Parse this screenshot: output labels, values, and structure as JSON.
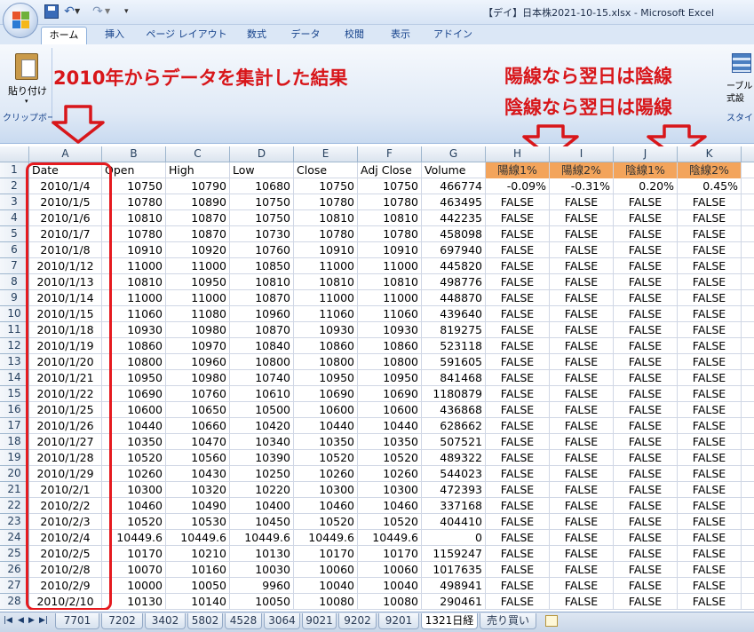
{
  "window": {
    "title": "【デイ】日本株2021-10-15.xlsx - Microsoft Excel"
  },
  "quick_access": {
    "save_icon": "save-icon",
    "undo_icon": "undo-icon",
    "redo_icon": "redo-icon",
    "undo_glyph": "↶",
    "redo_glyph": "↷",
    "dropdown_glyph": "▼",
    "customize_glyph": "▾"
  },
  "ribbon": {
    "tabs": [
      "ホーム",
      "挿入",
      "ページ レイアウト",
      "数式",
      "データ",
      "校閲",
      "表示",
      "アドイン"
    ],
    "active_tab": "ホーム",
    "paste_label": "貼り付け",
    "paste_arrow": "▾",
    "clipboard_group": "クリップボード",
    "right_label1": "ーブルと",
    "right_label2": "式設",
    "right_group": "スタイ"
  },
  "annotations": {
    "left": "2010年からデータを集計した結果",
    "right_line1": "陽線なら翌日は陰線",
    "right_line2": "陰線なら翌日は陽線",
    "color": "#d8161a"
  },
  "columns": [
    "A",
    "B",
    "C",
    "D",
    "E",
    "F",
    "G",
    "H",
    "I",
    "J",
    "K"
  ],
  "header_row": {
    "row_number": "1",
    "cells": [
      "Date",
      "Open",
      "High",
      "Low",
      "Close",
      "Adj Close",
      "Volume",
      "陽線1%",
      "陽線2%",
      "陰線1%",
      "陰線2%"
    ]
  },
  "rows": [
    {
      "n": "2",
      "cells": [
        "2010/1/4",
        "10750",
        "10790",
        "10680",
        "10750",
        "10750",
        "466774",
        "-0.09%",
        "-0.31%",
        "0.20%",
        "0.45%"
      ]
    },
    {
      "n": "3",
      "cells": [
        "2010/1/5",
        "10780",
        "10890",
        "10750",
        "10780",
        "10780",
        "463495",
        "FALSE",
        "FALSE",
        "FALSE",
        "FALSE"
      ]
    },
    {
      "n": "4",
      "cells": [
        "2010/1/6",
        "10810",
        "10870",
        "10750",
        "10810",
        "10810",
        "442235",
        "FALSE",
        "FALSE",
        "FALSE",
        "FALSE"
      ]
    },
    {
      "n": "5",
      "cells": [
        "2010/1/7",
        "10780",
        "10870",
        "10730",
        "10780",
        "10780",
        "458098",
        "FALSE",
        "FALSE",
        "FALSE",
        "FALSE"
      ]
    },
    {
      "n": "6",
      "cells": [
        "2010/1/8",
        "10910",
        "10920",
        "10760",
        "10910",
        "10910",
        "697940",
        "FALSE",
        "FALSE",
        "FALSE",
        "FALSE"
      ]
    },
    {
      "n": "7",
      "cells": [
        "2010/1/12",
        "11000",
        "11000",
        "10850",
        "11000",
        "11000",
        "445820",
        "FALSE",
        "FALSE",
        "FALSE",
        "FALSE"
      ]
    },
    {
      "n": "8",
      "cells": [
        "2010/1/13",
        "10810",
        "10950",
        "10810",
        "10810",
        "10810",
        "498776",
        "FALSE",
        "FALSE",
        "FALSE",
        "FALSE"
      ]
    },
    {
      "n": "9",
      "cells": [
        "2010/1/14",
        "11000",
        "11000",
        "10870",
        "11000",
        "11000",
        "448870",
        "FALSE",
        "FALSE",
        "FALSE",
        "FALSE"
      ]
    },
    {
      "n": "10",
      "cells": [
        "2010/1/15",
        "11060",
        "11080",
        "10960",
        "11060",
        "11060",
        "439640",
        "FALSE",
        "FALSE",
        "FALSE",
        "FALSE"
      ]
    },
    {
      "n": "11",
      "cells": [
        "2010/1/18",
        "10930",
        "10980",
        "10870",
        "10930",
        "10930",
        "819275",
        "FALSE",
        "FALSE",
        "FALSE",
        "FALSE"
      ]
    },
    {
      "n": "12",
      "cells": [
        "2010/1/19",
        "10860",
        "10970",
        "10840",
        "10860",
        "10860",
        "523118",
        "FALSE",
        "FALSE",
        "FALSE",
        "FALSE"
      ]
    },
    {
      "n": "13",
      "cells": [
        "2010/1/20",
        "10800",
        "10960",
        "10800",
        "10800",
        "10800",
        "591605",
        "FALSE",
        "FALSE",
        "FALSE",
        "FALSE"
      ]
    },
    {
      "n": "14",
      "cells": [
        "2010/1/21",
        "10950",
        "10980",
        "10740",
        "10950",
        "10950",
        "841468",
        "FALSE",
        "FALSE",
        "FALSE",
        "FALSE"
      ]
    },
    {
      "n": "15",
      "cells": [
        "2010/1/22",
        "10690",
        "10760",
        "10610",
        "10690",
        "10690",
        "1180879",
        "FALSE",
        "FALSE",
        "FALSE",
        "FALSE"
      ]
    },
    {
      "n": "16",
      "cells": [
        "2010/1/25",
        "10600",
        "10650",
        "10500",
        "10600",
        "10600",
        "436868",
        "FALSE",
        "FALSE",
        "FALSE",
        "FALSE"
      ]
    },
    {
      "n": "17",
      "cells": [
        "2010/1/26",
        "10440",
        "10660",
        "10420",
        "10440",
        "10440",
        "628662",
        "FALSE",
        "FALSE",
        "FALSE",
        "FALSE"
      ]
    },
    {
      "n": "18",
      "cells": [
        "2010/1/27",
        "10350",
        "10470",
        "10340",
        "10350",
        "10350",
        "507521",
        "FALSE",
        "FALSE",
        "FALSE",
        "FALSE"
      ]
    },
    {
      "n": "19",
      "cells": [
        "2010/1/28",
        "10520",
        "10560",
        "10390",
        "10520",
        "10520",
        "489322",
        "FALSE",
        "FALSE",
        "FALSE",
        "FALSE"
      ]
    },
    {
      "n": "20",
      "cells": [
        "2010/1/29",
        "10260",
        "10430",
        "10250",
        "10260",
        "10260",
        "544023",
        "FALSE",
        "FALSE",
        "FALSE",
        "FALSE"
      ]
    },
    {
      "n": "21",
      "cells": [
        "2010/2/1",
        "10300",
        "10320",
        "10220",
        "10300",
        "10300",
        "472393",
        "FALSE",
        "FALSE",
        "FALSE",
        "FALSE"
      ]
    },
    {
      "n": "22",
      "cells": [
        "2010/2/2",
        "10460",
        "10490",
        "10400",
        "10460",
        "10460",
        "337168",
        "FALSE",
        "FALSE",
        "FALSE",
        "FALSE"
      ]
    },
    {
      "n": "23",
      "cells": [
        "2010/2/3",
        "10520",
        "10530",
        "10450",
        "10520",
        "10520",
        "404410",
        "FALSE",
        "FALSE",
        "FALSE",
        "FALSE"
      ]
    },
    {
      "n": "24",
      "cells": [
        "2010/2/4",
        "10449.6",
        "10449.6",
        "10449.6",
        "10449.6",
        "10449.6",
        "0",
        "FALSE",
        "FALSE",
        "FALSE",
        "FALSE"
      ]
    },
    {
      "n": "25",
      "cells": [
        "2010/2/5",
        "10170",
        "10210",
        "10130",
        "10170",
        "10170",
        "1159247",
        "FALSE",
        "FALSE",
        "FALSE",
        "FALSE"
      ]
    },
    {
      "n": "26",
      "cells": [
        "2010/2/8",
        "10070",
        "10160",
        "10030",
        "10060",
        "10060",
        "1017635",
        "FALSE",
        "FALSE",
        "FALSE",
        "FALSE"
      ]
    },
    {
      "n": "27",
      "cells": [
        "2010/2/9",
        "10000",
        "10050",
        "9960",
        "10040",
        "10040",
        "498941",
        "FALSE",
        "FALSE",
        "FALSE",
        "FALSE"
      ]
    },
    {
      "n": "28",
      "cells": [
        "2010/2/10",
        "10130",
        "10140",
        "10050",
        "10080",
        "10080",
        "290461",
        "FALSE",
        "FALSE",
        "FALSE",
        "FALSE"
      ]
    }
  ],
  "sheet_tabs": [
    "7701",
    "7202",
    "3402",
    "5802",
    "4528",
    "3064",
    "9021",
    "9202",
    "9201",
    "1321日経",
    "売り買い"
  ],
  "active_sheet": "1321日経",
  "sheet_nav": [
    "|◀",
    "◀",
    "▶",
    "▶|"
  ],
  "colors": {
    "orange_header": "#f3a45b",
    "highlight_box": "#e51a1f"
  }
}
